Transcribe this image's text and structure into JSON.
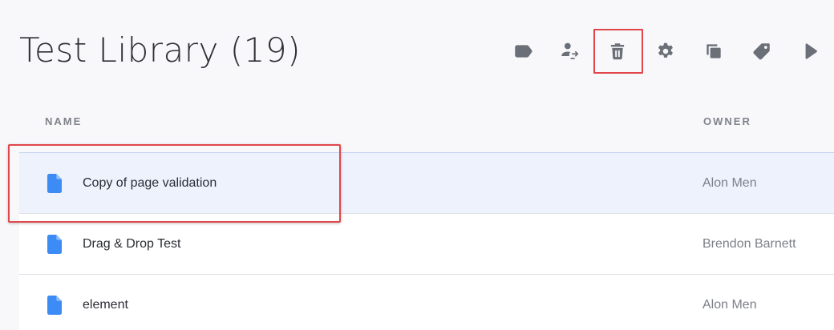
{
  "header": {
    "title": "Test Library (19)"
  },
  "toolbar": {
    "buttons": [
      {
        "name": "label-icon"
      },
      {
        "name": "transfer-owner-icon"
      },
      {
        "name": "trash-icon"
      },
      {
        "name": "gear-icon"
      },
      {
        "name": "duplicate-icon"
      },
      {
        "name": "tag-icon"
      },
      {
        "name": "play-icon"
      }
    ]
  },
  "table": {
    "columns": {
      "name": "NAME",
      "owner": "OWNER"
    },
    "rows": [
      {
        "name": "Copy of page validation",
        "owner": "Alon Men",
        "selected": true
      },
      {
        "name": "Drag & Drop Test",
        "owner": "Brendon Barnett",
        "selected": false
      },
      {
        "name": "element",
        "owner": "Alon Men",
        "selected": false
      }
    ]
  },
  "colors": {
    "accent": "#3d8bf5",
    "highlight": "#e0464a",
    "icon": "#6b6f78"
  }
}
